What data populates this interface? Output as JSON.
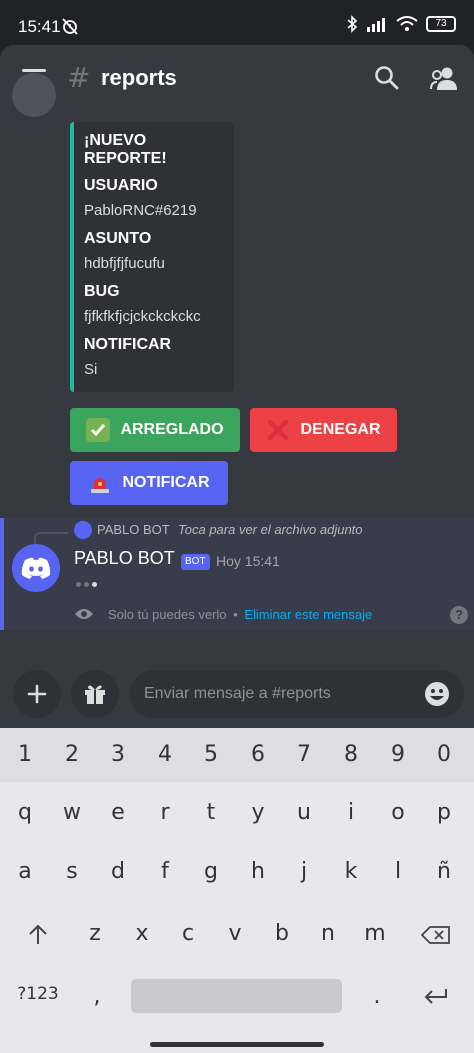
{
  "status_bar": {
    "time": "15:41",
    "battery": "73",
    "icons": [
      "alarm-off-icon",
      "bluetooth-icon",
      "signal-icon",
      "wifi-icon",
      "battery-icon"
    ]
  },
  "header": {
    "channel_prefix": "#",
    "channel_name": "reports"
  },
  "embed": {
    "accent_color": "#1abc9c",
    "title": "¡NUEVO REPORTE!",
    "fields": [
      {
        "name": "USUARIO",
        "value": "PabloRNC#6219"
      },
      {
        "name": "ASUNTO",
        "value": "hdbfjfjfucufu"
      },
      {
        "name": "BUG",
        "value": "fjfkfkfjcjckckckckc"
      },
      {
        "name": "NOTIFICAR",
        "value": "Si"
      }
    ]
  },
  "buttons": {
    "fixed": {
      "label": "ARREGLADO",
      "emoji": "✅",
      "color": "#3ba55d"
    },
    "deny": {
      "label": "DENEGAR",
      "emoji": "❌",
      "color": "#ed4245"
    },
    "notify": {
      "label": "NOTIFICAR",
      "emoji": "🚨",
      "color": "#5865f2"
    }
  },
  "ephemeral_message": {
    "reply_author": "PABLO BOT",
    "reply_text": "Toca para ver el archivo adjunto",
    "author": "PABLO BOT",
    "bot_tag": "BOT",
    "timestamp": "Hoy 15:41",
    "only_you_text": "Solo tú puedes verlo",
    "separator": "•",
    "delete_link": "Eliminar este mensaje",
    "help": "?"
  },
  "composer": {
    "placeholder": "Enviar mensaje a #reports"
  },
  "keyboard": {
    "numbers": [
      "1",
      "2",
      "3",
      "4",
      "5",
      "6",
      "7",
      "8",
      "9",
      "0"
    ],
    "row1": [
      "q",
      "w",
      "e",
      "r",
      "t",
      "y",
      "u",
      "i",
      "o",
      "p"
    ],
    "row2": [
      "a",
      "s",
      "d",
      "f",
      "g",
      "h",
      "j",
      "k",
      "l",
      "ñ"
    ],
    "row3": [
      "z",
      "x",
      "c",
      "v",
      "b",
      "n",
      "m"
    ],
    "symbols_key": "?123",
    "comma": ",",
    "period": "."
  },
  "colors": {
    "brand": "#5865f2",
    "background": "#36393f",
    "embed_bg": "#2f3136"
  }
}
